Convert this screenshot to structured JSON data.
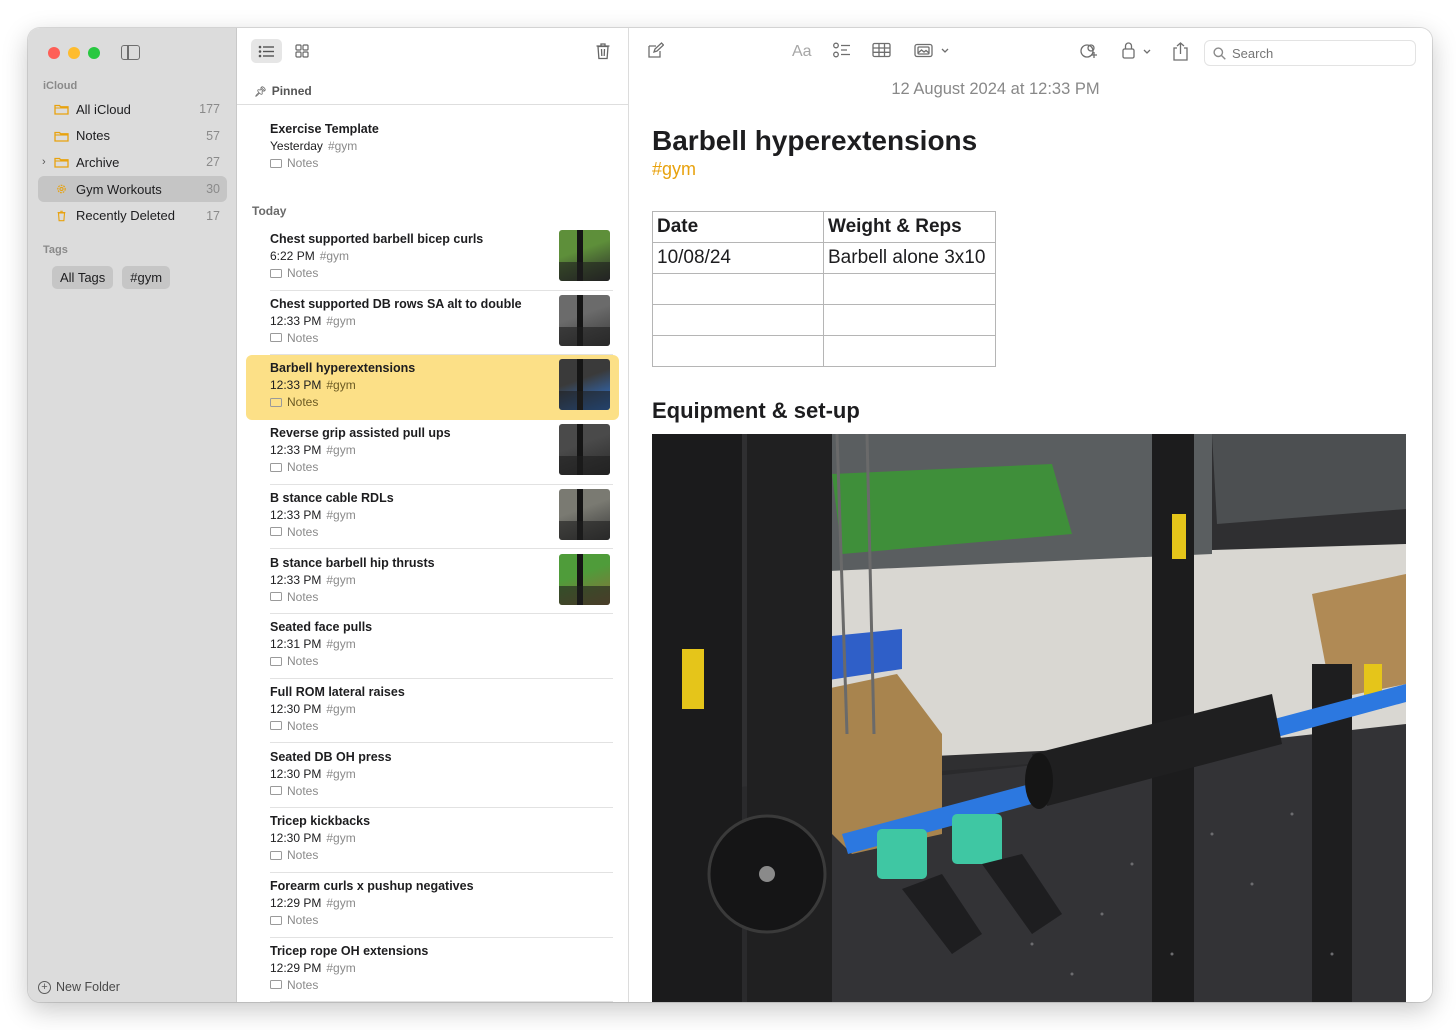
{
  "sidebar": {
    "section_icloud": "iCloud",
    "folders": [
      {
        "label": "All iCloud",
        "count": "177"
      },
      {
        "label": "Notes",
        "count": "57"
      },
      {
        "label": "Archive",
        "count": "27"
      },
      {
        "label": "Gym Workouts",
        "count": "30"
      },
      {
        "label": "Recently Deleted",
        "count": "17"
      }
    ],
    "section_tags": "Tags",
    "tags": [
      "All Tags",
      "#gym"
    ],
    "new_folder_label": "New Folder"
  },
  "list": {
    "pinned_label": "Pinned",
    "today_label": "Today",
    "pinned": [
      {
        "title": "Exercise Template",
        "time": "Yesterday",
        "tag": "#gym",
        "folder": "Notes"
      }
    ],
    "notes": [
      {
        "title": "Chest supported barbell bicep curls",
        "time": "6:22 PM",
        "tag": "#gym",
        "folder": "Notes"
      },
      {
        "title": "Chest supported DB rows SA alt to double",
        "time": "12:33 PM",
        "tag": "#gym",
        "folder": "Notes"
      },
      {
        "title": "Barbell hyperextensions",
        "time": "12:33 PM",
        "tag": "#gym",
        "folder": "Notes"
      },
      {
        "title": "Reverse grip assisted pull ups",
        "time": "12:33 PM",
        "tag": "#gym",
        "folder": "Notes"
      },
      {
        "title": "B stance cable RDLs",
        "time": "12:33 PM",
        "tag": "#gym",
        "folder": "Notes"
      },
      {
        "title": "B stance barbell hip thrusts",
        "time": "12:33 PM",
        "tag": "#gym",
        "folder": "Notes"
      },
      {
        "title": "Seated face pulls",
        "time": "12:31 PM",
        "tag": "#gym",
        "folder": "Notes"
      },
      {
        "title": "Full ROM lateral raises",
        "time": "12:30 PM",
        "tag": "#gym",
        "folder": "Notes"
      },
      {
        "title": "Seated DB OH press",
        "time": "12:30 PM",
        "tag": "#gym",
        "folder": "Notes"
      },
      {
        "title": "Tricep kickbacks",
        "time": "12:30 PM",
        "tag": "#gym",
        "folder": "Notes"
      },
      {
        "title": "Forearm curls x pushup negatives",
        "time": "12:29 PM",
        "tag": "#gym",
        "folder": "Notes"
      },
      {
        "title": "Tricep rope OH extensions",
        "time": "12:29 PM",
        "tag": "#gym",
        "folder": "Notes"
      }
    ]
  },
  "editor": {
    "toolbar": {
      "format_label": "Aa",
      "search_placeholder": "Search"
    },
    "date": "12 August 2024 at 12:33 PM",
    "title": "Barbell hyperextensions",
    "hashtag": "#gym",
    "table": {
      "headers": [
        "Date",
        "Weight & Reps"
      ],
      "rows": [
        [
          "10/08/24",
          "Barbell alone 3x10"
        ],
        [
          "",
          ""
        ],
        [
          "",
          ""
        ],
        [
          "",
          ""
        ]
      ]
    },
    "subheading": "Equipment & set-up"
  },
  "colors": {
    "accent": "#e8a20e",
    "selection": "#fce087",
    "sidebar_bg": "#dcdcdc"
  }
}
